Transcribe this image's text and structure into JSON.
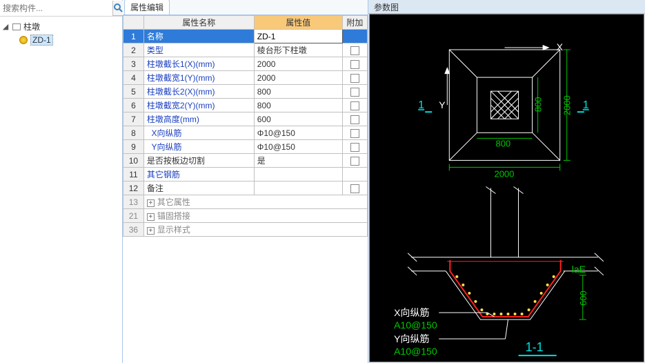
{
  "search": {
    "placeholder": "搜索构件..."
  },
  "tree": {
    "root": {
      "label": "柱墩",
      "expanded": true
    },
    "child": {
      "label": "ZD-1",
      "selected": true
    }
  },
  "tab": {
    "label": "属性编辑"
  },
  "grid": {
    "headers": {
      "name": "属性名称",
      "value": "属性值",
      "add": "附加"
    },
    "rows": [
      {
        "n": "1",
        "name": "名称",
        "value": "ZD-1",
        "blue": false,
        "hasCheck": false,
        "selected": true
      },
      {
        "n": "2",
        "name": "类型",
        "value": "棱台形下柱墩",
        "blue": true,
        "hasCheck": true
      },
      {
        "n": "3",
        "name": "柱墩截长1(X)(mm)",
        "value": "2000",
        "blue": true,
        "hasCheck": true
      },
      {
        "n": "4",
        "name": "柱墩截宽1(Y)(mm)",
        "value": "2000",
        "blue": true,
        "hasCheck": true
      },
      {
        "n": "5",
        "name": "柱墩截长2(X)(mm)",
        "value": "800",
        "blue": true,
        "hasCheck": true
      },
      {
        "n": "6",
        "name": "柱墩截宽2(Y)(mm)",
        "value": "800",
        "blue": true,
        "hasCheck": true
      },
      {
        "n": "7",
        "name": "柱墩高度(mm)",
        "value": "600",
        "blue": true,
        "hasCheck": true
      },
      {
        "n": "8",
        "name": "X向纵筋",
        "value": "Φ10@150",
        "blue": true,
        "hasCheck": true,
        "indent": true
      },
      {
        "n": "9",
        "name": "Y向纵筋",
        "value": "Φ10@150",
        "blue": true,
        "hasCheck": true,
        "indent": true
      },
      {
        "n": "10",
        "name": "是否按板边切割",
        "value": "是",
        "blue": false,
        "hasCheck": true
      },
      {
        "n": "11",
        "name": "其它钢筋",
        "value": "",
        "blue": true,
        "hasCheck": false
      },
      {
        "n": "12",
        "name": "备注",
        "value": "",
        "blue": false,
        "hasCheck": true
      }
    ],
    "groups": [
      {
        "n": "13",
        "name": "其它属性"
      },
      {
        "n": "21",
        "name": "锚固搭接"
      },
      {
        "n": "36",
        "name": "显示样式"
      }
    ]
  },
  "right": {
    "title": "参数图"
  },
  "diagram": {
    "top": {
      "X_label": "X",
      "Y_label": "Y",
      "outer_w": "2000",
      "outer_h": "2000",
      "inner_w": "800",
      "inner_h": "800",
      "section_left": "1",
      "section_right": "1"
    },
    "bottom": {
      "lae": "laE",
      "height": "600",
      "x_label": "X向纵筋",
      "x_spec": "A10@150",
      "y_label": "Y向纵筋",
      "y_spec": "A10@150",
      "section": "1-1"
    }
  }
}
